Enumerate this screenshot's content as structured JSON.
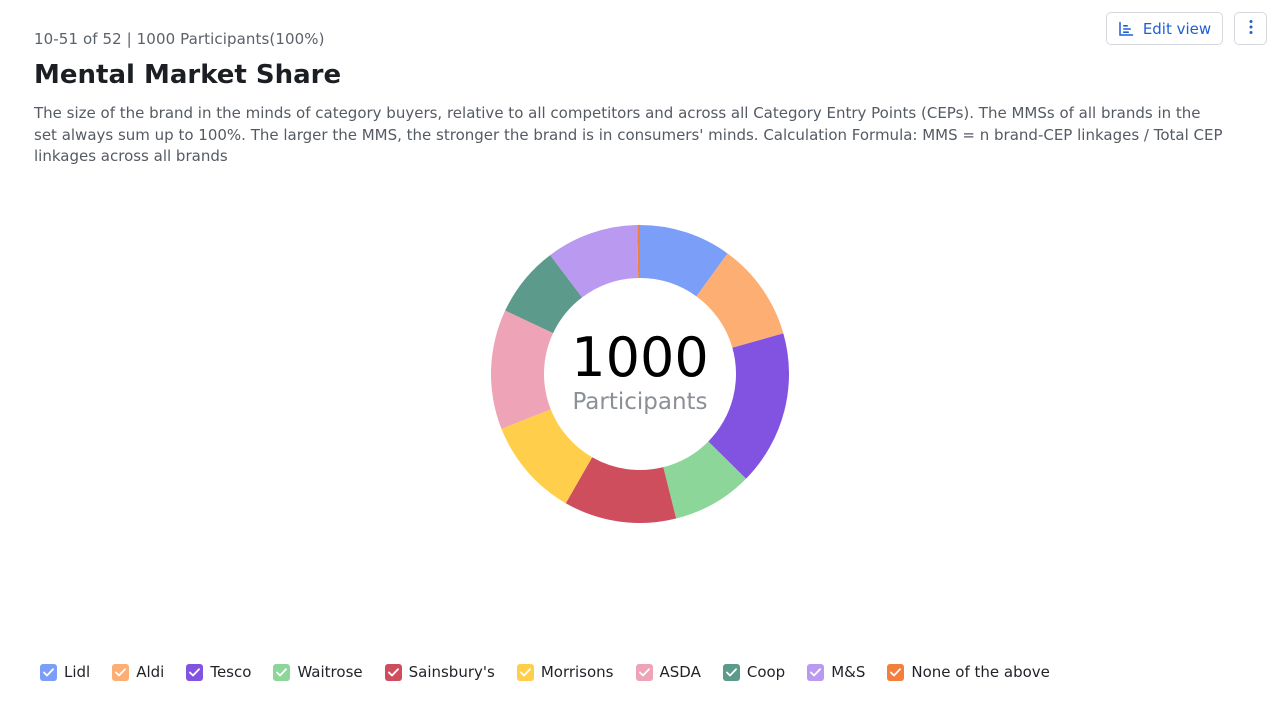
{
  "header": {
    "meta": "10-51 of 52 | 1000 Participants(100%)",
    "title": "Mental Market Share",
    "description": "The size of the brand in the minds of category buyers, relative to all competitors and across all Category Entry Points (CEPs). The MMSs of all brands in the set always sum up to 100%. The larger the MMS, the stronger the brand is in consumers' minds. Calculation Formula: MMS = n brand-CEP linkages / Total CEP linkages across all brands"
  },
  "toolbar": {
    "edit_view_label": "Edit view",
    "edit_view_icon": "bar-chart-icon",
    "more_icon": "more-vertical-icon",
    "accent_color": "#1f5fd6"
  },
  "center": {
    "count": "1000",
    "label": "Participants"
  },
  "chart_data": {
    "type": "pie",
    "start_angle_deg": 0,
    "direction": "clockwise",
    "grid": false,
    "legend_position": "bottom-left",
    "slices": [
      {
        "name": "Lidl",
        "value": 10.0,
        "color": "#7B9EF8",
        "checked": true
      },
      {
        "name": "Aldi",
        "value": 10.6,
        "color": "#FDAE73",
        "checked": true
      },
      {
        "name": "Tesco",
        "value": 16.8,
        "color": "#8253E0",
        "checked": true
      },
      {
        "name": "Waitrose",
        "value": 8.7,
        "color": "#8DD69A",
        "checked": true
      },
      {
        "name": "Sainsbury's",
        "value": 12.2,
        "color": "#CE4E5E",
        "checked": true
      },
      {
        "name": "Morrisons",
        "value": 10.7,
        "color": "#FFCE4B",
        "checked": true
      },
      {
        "name": "ASDA",
        "value": 13.0,
        "color": "#EEA3B7",
        "checked": true
      },
      {
        "name": "Coop",
        "value": 7.7,
        "color": "#5C9A8B",
        "checked": true
      },
      {
        "name": "M&S",
        "value": 10.0,
        "color": "#BA9AF1",
        "checked": true
      },
      {
        "name": "None of the above",
        "value": 0.3,
        "color": "#F47E3C",
        "checked": true
      }
    ]
  }
}
